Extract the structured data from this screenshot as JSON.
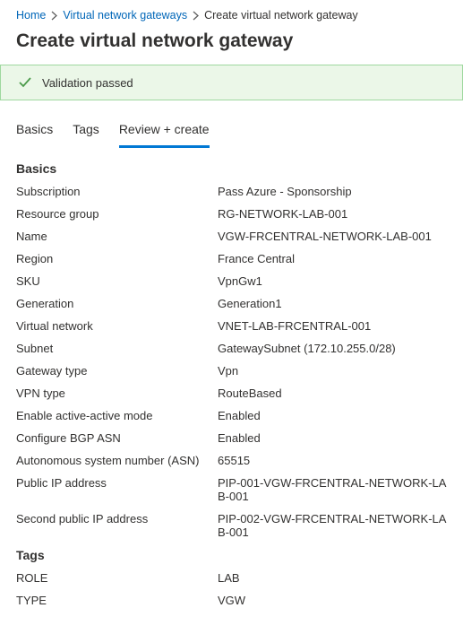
{
  "breadcrumb": {
    "home": "Home",
    "gateways": "Virtual network gateways",
    "current": "Create virtual network gateway"
  },
  "title": "Create virtual network gateway",
  "validation": {
    "message": "Validation passed"
  },
  "tabs": {
    "basics": "Basics",
    "tags": "Tags",
    "review": "Review + create"
  },
  "sections": {
    "basics": {
      "heading": "Basics",
      "rows": {
        "subscription_label": "Subscription",
        "subscription_value": "Pass Azure - Sponsorship",
        "rg_label": "Resource group",
        "rg_value": "RG-NETWORK-LAB-001",
        "name_label": "Name",
        "name_value": "VGW-FRCENTRAL-NETWORK-LAB-001",
        "region_label": "Region",
        "region_value": "France Central",
        "sku_label": "SKU",
        "sku_value": "VpnGw1",
        "gen_label": "Generation",
        "gen_value": "Generation1",
        "vnet_label": "Virtual network",
        "vnet_value": "VNET-LAB-FRCENTRAL-001",
        "subnet_label": "Subnet",
        "subnet_value": "GatewaySubnet (172.10.255.0/28)",
        "gwtype_label": "Gateway type",
        "gwtype_value": "Vpn",
        "vpntype_label": "VPN type",
        "vpntype_value": "RouteBased",
        "aa_label": "Enable active-active mode",
        "aa_value": "Enabled",
        "bgp_label": "Configure BGP ASN",
        "bgp_value": "Enabled",
        "asn_label": "Autonomous system number (ASN)",
        "asn_value": "65515",
        "pip1_label": "Public IP address",
        "pip1_value": "PIP-001-VGW-FRCENTRAL-NETWORK-LAB-001",
        "pip2_label": "Second public IP address",
        "pip2_value": "PIP-002-VGW-FRCENTRAL-NETWORK-LAB-001"
      }
    },
    "tags": {
      "heading": "Tags",
      "rows": {
        "role_label": "ROLE",
        "role_value": "LAB",
        "type_label": "TYPE",
        "type_value": "VGW"
      }
    }
  }
}
